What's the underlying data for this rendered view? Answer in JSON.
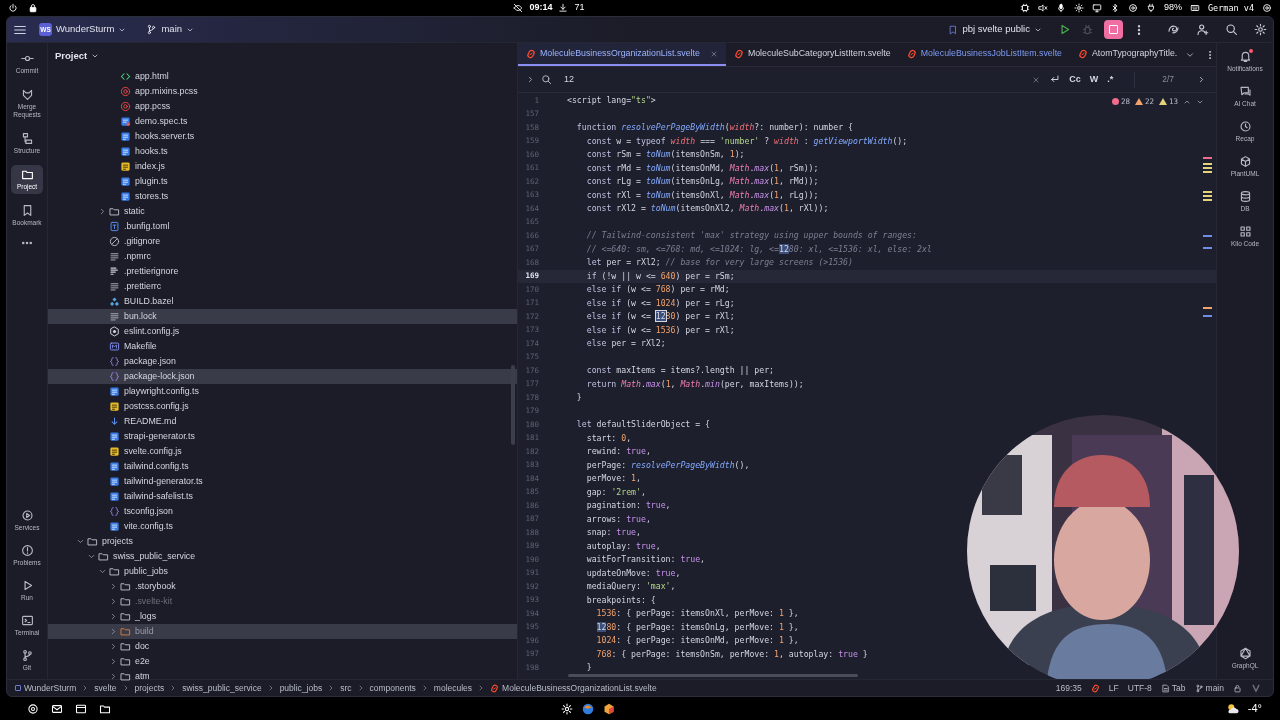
{
  "system_bar": {
    "clock": "09:14",
    "downloads": "71",
    "battery": "98%",
    "keyboard_layout": "German v4"
  },
  "header": {
    "project_badge": "WS",
    "project": "WunderSturm",
    "branch": "main",
    "run_config": "pbj svelte public"
  },
  "left_toolbar": {
    "top": [
      {
        "label": "Commit",
        "kind": "commit",
        "selected": false
      },
      {
        "label": "Merge Requests",
        "kind": "merge",
        "selected": false
      },
      {
        "label": "Structure",
        "kind": "structure",
        "selected": false
      },
      {
        "label": "Project",
        "kind": "folder",
        "selected": true
      },
      {
        "label": "Bookmark",
        "kind": "bookmark",
        "selected": false
      }
    ],
    "bottom": [
      {
        "label": "Services",
        "kind": "services",
        "selected": false
      },
      {
        "label": "Problems",
        "kind": "problems",
        "selected": false
      },
      {
        "label": "Run",
        "kind": "run",
        "selected": false
      },
      {
        "label": "Terminal",
        "kind": "terminal",
        "selected": false
      },
      {
        "label": "Git",
        "kind": "git",
        "selected": false
      }
    ]
  },
  "project_panel": {
    "title": "Project",
    "tree": [
      {
        "children": [
          {
            "children": [
              {
                "children": [
                  {
                    "label": "app.html",
                    "kind": "html",
                    "selected": false
                  },
                  {
                    "label": "app.mixins.pcss",
                    "kind": "pcss",
                    "selected": false
                  },
                  {
                    "label": "app.pcss",
                    "kind": "pcss",
                    "selected": false
                  },
                  {
                    "label": "demo.spec.ts",
                    "kind": "test",
                    "selected": false
                  },
                  {
                    "label": "hooks.server.ts",
                    "kind": "ts",
                    "selected": false
                  },
                  {
                    "label": "hooks.ts",
                    "kind": "ts",
                    "selected": false
                  },
                  {
                    "label": "index.js",
                    "kind": "js",
                    "selected": false
                  },
                  {
                    "label": "plugin.ts",
                    "kind": "ts",
                    "selected": false
                  },
                  {
                    "label": "stores.ts",
                    "kind": "ts",
                    "selected": false
                  }
                ]
              },
              {
                "label": "static",
                "kind": "folder",
                "expanded": false,
                "selected": false
              },
              {
                "label": ".bunfig.toml",
                "kind": "toml",
                "selected": false
              },
              {
                "label": ".gitignore",
                "kind": "ignore",
                "selected": false
              },
              {
                "label": ".npmrc",
                "kind": "text",
                "selected": false
              },
              {
                "label": ".prettierignore",
                "kind": "prettier",
                "selected": false
              },
              {
                "label": ".prettierrc",
                "kind": "text",
                "selected": false
              },
              {
                "label": "BUILD.bazel",
                "kind": "bazel",
                "selected": false
              },
              {
                "label": "bun.lock",
                "kind": "text",
                "selected": true
              },
              {
                "label": "eslint.config.js",
                "kind": "eslint",
                "selected": false
              },
              {
                "label": "Makefile",
                "kind": "make",
                "selected": false
              },
              {
                "label": "package.json",
                "kind": "json",
                "selected": false
              },
              {
                "label": "package-lock.json",
                "kind": "json",
                "selected": true
              },
              {
                "label": "playwright.config.ts",
                "kind": "ts",
                "selected": false
              },
              {
                "label": "postcss.config.js",
                "kind": "js",
                "selected": false
              },
              {
                "label": "README.md",
                "kind": "md",
                "selected": false
              },
              {
                "label": "strapi-generator.ts",
                "kind": "ts",
                "selected": false
              },
              {
                "label": "svelte.config.js",
                "kind": "js",
                "selected": false
              },
              {
                "label": "tailwind.config.ts",
                "kind": "ts",
                "selected": false
              },
              {
                "label": "tailwind-generator.ts",
                "kind": "ts",
                "selected": false
              },
              {
                "label": "tailwind-safelist.ts",
                "kind": "ts",
                "selected": false
              },
              {
                "label": "tsconfig.json",
                "kind": "json",
                "selected": false
              },
              {
                "label": "vite.config.ts",
                "kind": "ts",
                "selected": false
              }
            ]
          }
        ]
      },
      {
        "label": "projects",
        "kind": "folder",
        "expanded": true,
        "selected": false,
        "children": [
          {
            "label": "swiss_public_service",
            "kind": "folder",
            "expanded": true,
            "selected": false,
            "children": [
              {
                "label": "public_jobs",
                "kind": "folder",
                "expanded": true,
                "selected": false,
                "children": [
                  {
                    "label": ".storybook",
                    "kind": "folder",
                    "expanded": false,
                    "selected": false
                  },
                  {
                    "label": ".svelte-kit",
                    "kind": "folder",
                    "expanded": false,
                    "selected": false,
                    "ignored": true
                  },
                  {
                    "label": "_logs",
                    "kind": "folder",
                    "expanded": false,
                    "selected": false
                  },
                  {
                    "label": "build",
                    "kind": "folder",
                    "expanded": false,
                    "selected": true,
                    "excluded": true
                  },
                  {
                    "label": "doc",
                    "kind": "folder",
                    "expanded": false,
                    "selected": false
                  },
                  {
                    "label": "e2e",
                    "kind": "folder",
                    "expanded": false,
                    "selected": false
                  },
                  {
                    "label": "atm",
                    "kind": "folder",
                    "selected": false
                  }
                ]
              }
            ]
          }
        ]
      }
    ]
  },
  "editor": {
    "tabs": [
      {
        "label": "MoleculeBusinessOrganizationList.svelte",
        "selected": true,
        "modified": false
      },
      {
        "label": "MoleculeSubCategoryListItem.svelte",
        "selected": false,
        "modified": false
      },
      {
        "label": "MoleculeBusinessJobListItem.svelte",
        "selected": false,
        "modified": true
      },
      {
        "label": "AtomTypographyTitle.",
        "selected": false,
        "modified": false
      }
    ],
    "search": {
      "value": "12",
      "match_case": "Cc",
      "words": "W",
      "regex": ".*",
      "matches": "2/7"
    },
    "inspections": {
      "errors": "28",
      "warnings": "22",
      "weak_warnings": "13"
    },
    "lines": [
      {
        "number": "1",
        "current": false,
        "tokens": [
          {
            "kind": "plain",
            "text": "<script lang="
          },
          {
            "kind": "str",
            "text": "\"ts\""
          },
          {
            "kind": "plain",
            "text": ">"
          }
        ]
      },
      {
        "number": "157",
        "current": false
      },
      {
        "number": "158",
        "current": false,
        "tokens": [
          {
            "kind": "kw",
            "text": "  function "
          },
          {
            "kind": "fn",
            "text": "resolvePerPageByWidth"
          },
          {
            "kind": "plain",
            "text": "("
          },
          {
            "kind": "param",
            "text": "width"
          },
          {
            "kind": "plain",
            "text": "?: number): number {"
          }
        ]
      },
      {
        "number": "159",
        "current": false,
        "tokens": [
          {
            "kind": "kw",
            "text": "    const"
          },
          {
            "kind": "plain",
            "text": " w = "
          },
          {
            "kind": "kw",
            "text": "typeof "
          },
          {
            "kind": "param",
            "text": "width"
          },
          {
            "kind": "plain",
            "text": " === "
          },
          {
            "kind": "str",
            "text": "'number'"
          },
          {
            "kind": "plain",
            "text": " ? "
          },
          {
            "kind": "param",
            "text": "width"
          },
          {
            "kind": "plain",
            "text": " : "
          },
          {
            "kind": "fn",
            "text": "getViewportWidth"
          },
          {
            "kind": "plain",
            "text": "();"
          }
        ]
      },
      {
        "number": "160",
        "current": false,
        "tokens": [
          {
            "kind": "kw",
            "text": "    const"
          },
          {
            "kind": "plain",
            "text": " rSm = "
          },
          {
            "kind": "fn",
            "text": "toNum"
          },
          {
            "kind": "plain",
            "text": "(itemsOnSm, "
          },
          {
            "kind": "num",
            "text": "1"
          },
          {
            "kind": "plain",
            "text": ");"
          }
        ]
      },
      {
        "number": "161",
        "current": false,
        "tokens": [
          {
            "kind": "kw",
            "text": "    const"
          },
          {
            "kind": "plain",
            "text": " rMd = "
          },
          {
            "kind": "fn",
            "text": "toNum"
          },
          {
            "kind": "plain",
            "text": "(itemsOnMd, "
          },
          {
            "kind": "obj",
            "text": "Math"
          },
          {
            "kind": "plain",
            "text": "."
          },
          {
            "kind": "method",
            "text": "max"
          },
          {
            "kind": "plain",
            "text": "("
          },
          {
            "kind": "num",
            "text": "1"
          },
          {
            "kind": "plain",
            "text": ", rSm));"
          }
        ]
      },
      {
        "number": "162",
        "current": false,
        "tokens": [
          {
            "kind": "kw",
            "text": "    const"
          },
          {
            "kind": "plain",
            "text": " rLg = "
          },
          {
            "kind": "fn",
            "text": "toNum"
          },
          {
            "kind": "plain",
            "text": "(itemsOnLg, "
          },
          {
            "kind": "obj",
            "text": "Math"
          },
          {
            "kind": "plain",
            "text": "."
          },
          {
            "kind": "method",
            "text": "max"
          },
          {
            "kind": "plain",
            "text": "("
          },
          {
            "kind": "num",
            "text": "1"
          },
          {
            "kind": "plain",
            "text": ", rMd));"
          }
        ]
      },
      {
        "number": "163",
        "current": false,
        "tokens": [
          {
            "kind": "kw",
            "text": "    const"
          },
          {
            "kind": "plain",
            "text": " rXl = "
          },
          {
            "kind": "fn",
            "text": "toNum"
          },
          {
            "kind": "plain",
            "text": "(itemsOnXl, "
          },
          {
            "kind": "obj",
            "text": "Math"
          },
          {
            "kind": "plain",
            "text": "."
          },
          {
            "kind": "method",
            "text": "max"
          },
          {
            "kind": "plain",
            "text": "("
          },
          {
            "kind": "num",
            "text": "1"
          },
          {
            "kind": "plain",
            "text": ", rLg));"
          }
        ]
      },
      {
        "number": "164",
        "current": false,
        "tokens": [
          {
            "kind": "kw",
            "text": "    const"
          },
          {
            "kind": "plain",
            "text": " rXl2 = "
          },
          {
            "kind": "fn",
            "text": "toNum"
          },
          {
            "kind": "plain",
            "text": "(itemsOnXl2, "
          },
          {
            "kind": "obj",
            "text": "Math"
          },
          {
            "kind": "plain",
            "text": "."
          },
          {
            "kind": "method",
            "text": "max"
          },
          {
            "kind": "plain",
            "text": "("
          },
          {
            "kind": "num",
            "text": "1"
          },
          {
            "kind": "plain",
            "text": ", rXl));"
          }
        ]
      },
      {
        "number": "165",
        "current": false
      },
      {
        "number": "166",
        "current": false,
        "tokens": [
          {
            "kind": "cmt",
            "text": "    // Tailwind-consistent 'max' strategy using upper bounds of ranges:"
          }
        ]
      },
      {
        "number": "167",
        "current": false,
        "tokens": [
          {
            "kind": "cmt",
            "text": "    // <=640: sm, <=768: md, <=1024: lg, <="
          },
          {
            "kind": "match",
            "text": "12"
          },
          {
            "kind": "cmt",
            "text": "80: xl, <=1536: xl, else: 2xl"
          }
        ]
      },
      {
        "number": "168",
        "current": false,
        "tokens": [
          {
            "kind": "kw",
            "text": "    let"
          },
          {
            "kind": "plain",
            "text": " per = rXl2; "
          },
          {
            "kind": "cmt",
            "text": "// base for very large screens (>1536)"
          }
        ]
      },
      {
        "number": "169",
        "current": true,
        "tokens": [
          {
            "kind": "kw",
            "text": "    if"
          },
          {
            "kind": "plain",
            "text": " (!w || w <= "
          },
          {
            "kind": "num",
            "text": "640"
          },
          {
            "kind": "plain",
            "text": ") per = rSm;"
          }
        ]
      },
      {
        "number": "170",
        "current": false,
        "tokens": [
          {
            "kind": "kw",
            "text": "    else if"
          },
          {
            "kind": "plain",
            "text": " (w <= "
          },
          {
            "kind": "num",
            "text": "768"
          },
          {
            "kind": "plain",
            "text": ") per = rMd;"
          }
        ]
      },
      {
        "number": "171",
        "current": false,
        "tokens": [
          {
            "kind": "kw",
            "text": "    else if"
          },
          {
            "kind": "plain",
            "text": " (w <= "
          },
          {
            "kind": "num",
            "text": "1024"
          },
          {
            "kind": "plain",
            "text": ") per = rLg;"
          }
        ]
      },
      {
        "number": "172",
        "current": false,
        "tokens": [
          {
            "kind": "kw",
            "text": "    else if"
          },
          {
            "kind": "plain",
            "text": " (w <= "
          },
          {
            "kind": "current_match",
            "text": "12"
          },
          {
            "kind": "num",
            "text": "80"
          },
          {
            "kind": "plain",
            "text": ") per = rXl;"
          }
        ]
      },
      {
        "number": "173",
        "current": false,
        "tokens": [
          {
            "kind": "kw",
            "text": "    else if"
          },
          {
            "kind": "plain",
            "text": " (w <= "
          },
          {
            "kind": "num",
            "text": "1536"
          },
          {
            "kind": "plain",
            "text": ") per = rXl;"
          }
        ]
      },
      {
        "number": "174",
        "current": false,
        "tokens": [
          {
            "kind": "kw",
            "text": "    else"
          },
          {
            "kind": "plain",
            "text": " per = rXl2;"
          }
        ]
      },
      {
        "number": "175",
        "current": false
      },
      {
        "number": "176",
        "current": false,
        "tokens": [
          {
            "kind": "kw",
            "text": "    const"
          },
          {
            "kind": "plain",
            "text": " maxItems = items?.length || per;"
          }
        ]
      },
      {
        "number": "177",
        "current": false,
        "tokens": [
          {
            "kind": "kw",
            "text": "    return "
          },
          {
            "kind": "obj",
            "text": "Math"
          },
          {
            "kind": "plain",
            "text": "."
          },
          {
            "kind": "method",
            "text": "max"
          },
          {
            "kind": "plain",
            "text": "("
          },
          {
            "kind": "num",
            "text": "1"
          },
          {
            "kind": "plain",
            "text": ", "
          },
          {
            "kind": "obj",
            "text": "Math"
          },
          {
            "kind": "plain",
            "text": "."
          },
          {
            "kind": "method",
            "text": "min"
          },
          {
            "kind": "plain",
            "text": "(per, maxItems));"
          }
        ]
      },
      {
        "number": "178",
        "current": false,
        "tokens": [
          {
            "kind": "plain",
            "text": "  }"
          }
        ]
      },
      {
        "number": "179",
        "current": false
      },
      {
        "number": "180",
        "current": false,
        "tokens": [
          {
            "kind": "kw",
            "text": "  let"
          },
          {
            "kind": "plain",
            "text": " defaultSliderObject = {"
          }
        ]
      },
      {
        "number": "181",
        "current": false,
        "tokens": [
          {
            "kind": "plain",
            "text": "    start: "
          },
          {
            "kind": "num",
            "text": "0"
          },
          {
            "kind": "plain",
            "text": ","
          }
        ]
      },
      {
        "number": "182",
        "current": false,
        "tokens": [
          {
            "kind": "plain",
            "text": "    rewind: "
          },
          {
            "kind": "bool",
            "text": "true"
          },
          {
            "kind": "plain",
            "text": ","
          }
        ]
      },
      {
        "number": "183",
        "current": false,
        "tokens": [
          {
            "kind": "plain",
            "text": "    perPage: "
          },
          {
            "kind": "fn",
            "text": "resolvePerPageByWidth"
          },
          {
            "kind": "plain",
            "text": "(),"
          }
        ]
      },
      {
        "number": "184",
        "current": false,
        "tokens": [
          {
            "kind": "plain",
            "text": "    perMove: "
          },
          {
            "kind": "num",
            "text": "1"
          },
          {
            "kind": "plain",
            "text": ","
          }
        ]
      },
      {
        "number": "185",
        "current": false,
        "tokens": [
          {
            "kind": "plain",
            "text": "    gap: "
          },
          {
            "kind": "str",
            "text": "'2rem'"
          },
          {
            "kind": "plain",
            "text": ","
          }
        ]
      },
      {
        "number": "186",
        "current": false,
        "tokens": [
          {
            "kind": "plain",
            "text": "    pagination: "
          },
          {
            "kind": "bool",
            "text": "true"
          },
          {
            "kind": "plain",
            "text": ","
          }
        ]
      },
      {
        "number": "187",
        "current": false,
        "tokens": [
          {
            "kind": "plain",
            "text": "    arrows: "
          },
          {
            "kind": "bool",
            "text": "true"
          },
          {
            "kind": "plain",
            "text": ","
          }
        ]
      },
      {
        "number": "188",
        "current": false,
        "tokens": [
          {
            "kind": "plain",
            "text": "    snap: "
          },
          {
            "kind": "bool",
            "text": "true"
          },
          {
            "kind": "plain",
            "text": ","
          }
        ]
      },
      {
        "number": "189",
        "current": false,
        "tokens": [
          {
            "kind": "plain",
            "text": "    autoplay: "
          },
          {
            "kind": "bool",
            "text": "true"
          },
          {
            "kind": "plain",
            "text": ","
          }
        ]
      },
      {
        "number": "190",
        "current": false,
        "tokens": [
          {
            "kind": "plain",
            "text": "    waitForTransition: "
          },
          {
            "kind": "bool",
            "text": "true"
          },
          {
            "kind": "plain",
            "text": ","
          }
        ]
      },
      {
        "number": "191",
        "current": false,
        "tokens": [
          {
            "kind": "plain",
            "text": "    updateOnMove: "
          },
          {
            "kind": "bool",
            "text": "true"
          },
          {
            "kind": "plain",
            "text": ","
          }
        ]
      },
      {
        "number": "192",
        "current": false,
        "tokens": [
          {
            "kind": "plain",
            "text": "    mediaQuery: "
          },
          {
            "kind": "str",
            "text": "'max'"
          },
          {
            "kind": "plain",
            "text": ","
          }
        ]
      },
      {
        "number": "193",
        "current": false,
        "tokens": [
          {
            "kind": "plain",
            "text": "    breakpoints: {"
          }
        ]
      },
      {
        "number": "194",
        "current": false,
        "tokens": [
          {
            "kind": "num",
            "text": "      1536"
          },
          {
            "kind": "plain",
            "text": ": { perPage: itemsOnXl, perMove: "
          },
          {
            "kind": "num",
            "text": "1"
          },
          {
            "kind": "plain",
            "text": " },"
          }
        ]
      },
      {
        "number": "195",
        "current": false,
        "tokens": [
          {
            "kind": "match",
            "text": "      12"
          },
          {
            "kind": "num",
            "text": "80"
          },
          {
            "kind": "plain",
            "text": ": { perPage: itemsOnLg, perMove: "
          },
          {
            "kind": "num",
            "text": "1"
          },
          {
            "kind": "plain",
            "text": " },"
          }
        ]
      },
      {
        "number": "196",
        "current": false,
        "tokens": [
          {
            "kind": "num",
            "text": "      1024"
          },
          {
            "kind": "plain",
            "text": ": { perPage: itemsOnMd, perMove: "
          },
          {
            "kind": "num",
            "text": "1"
          },
          {
            "kind": "plain",
            "text": " },"
          }
        ]
      },
      {
        "number": "197",
        "current": false,
        "tokens": [
          {
            "kind": "num",
            "text": "      768"
          },
          {
            "kind": "plain",
            "text": ": { perPage: itemsOnSm, perMove: "
          },
          {
            "kind": "num",
            "text": "1"
          },
          {
            "kind": "plain",
            "text": ", autoplay: "
          },
          {
            "kind": "bool",
            "text": "true"
          },
          {
            "kind": "plain",
            "text": " }"
          }
        ]
      },
      {
        "number": "198",
        "current": false,
        "tokens": [
          {
            "kind": "plain",
            "text": "    }"
          }
        ]
      }
    ]
  },
  "right_toolbar": [
    {
      "label": "Notifications",
      "kind": "bell",
      "badge": true
    },
    {
      "label": "AI Chat",
      "kind": "chat",
      "badge": false
    },
    {
      "label": "Recap",
      "kind": "clock",
      "badge": false
    },
    {
      "label": "PlantUML",
      "kind": "cube",
      "badge": false
    },
    {
      "label": "DB",
      "kind": "database",
      "badge": false
    },
    {
      "label": "Kilo Code",
      "kind": "grid",
      "badge": false
    }
  ],
  "right_toolbar_bottom": [
    {
      "label": "GraphQL",
      "kind": "graph",
      "badge": false
    }
  ],
  "status_bar": {
    "breadcrumbs": [
      "WunderSturm",
      "svelte",
      "projects",
      "swiss_public_service",
      "public_jobs",
      "src",
      "components",
      "molecules",
      "MoleculeBusinessOrganizationList.svelte"
    ],
    "position": "169:35",
    "line_separator": "LF",
    "encoding": "UTF-8",
    "indent": "Tab",
    "branch": "main"
  },
  "taskbar": {
    "temperature": "-4°"
  }
}
